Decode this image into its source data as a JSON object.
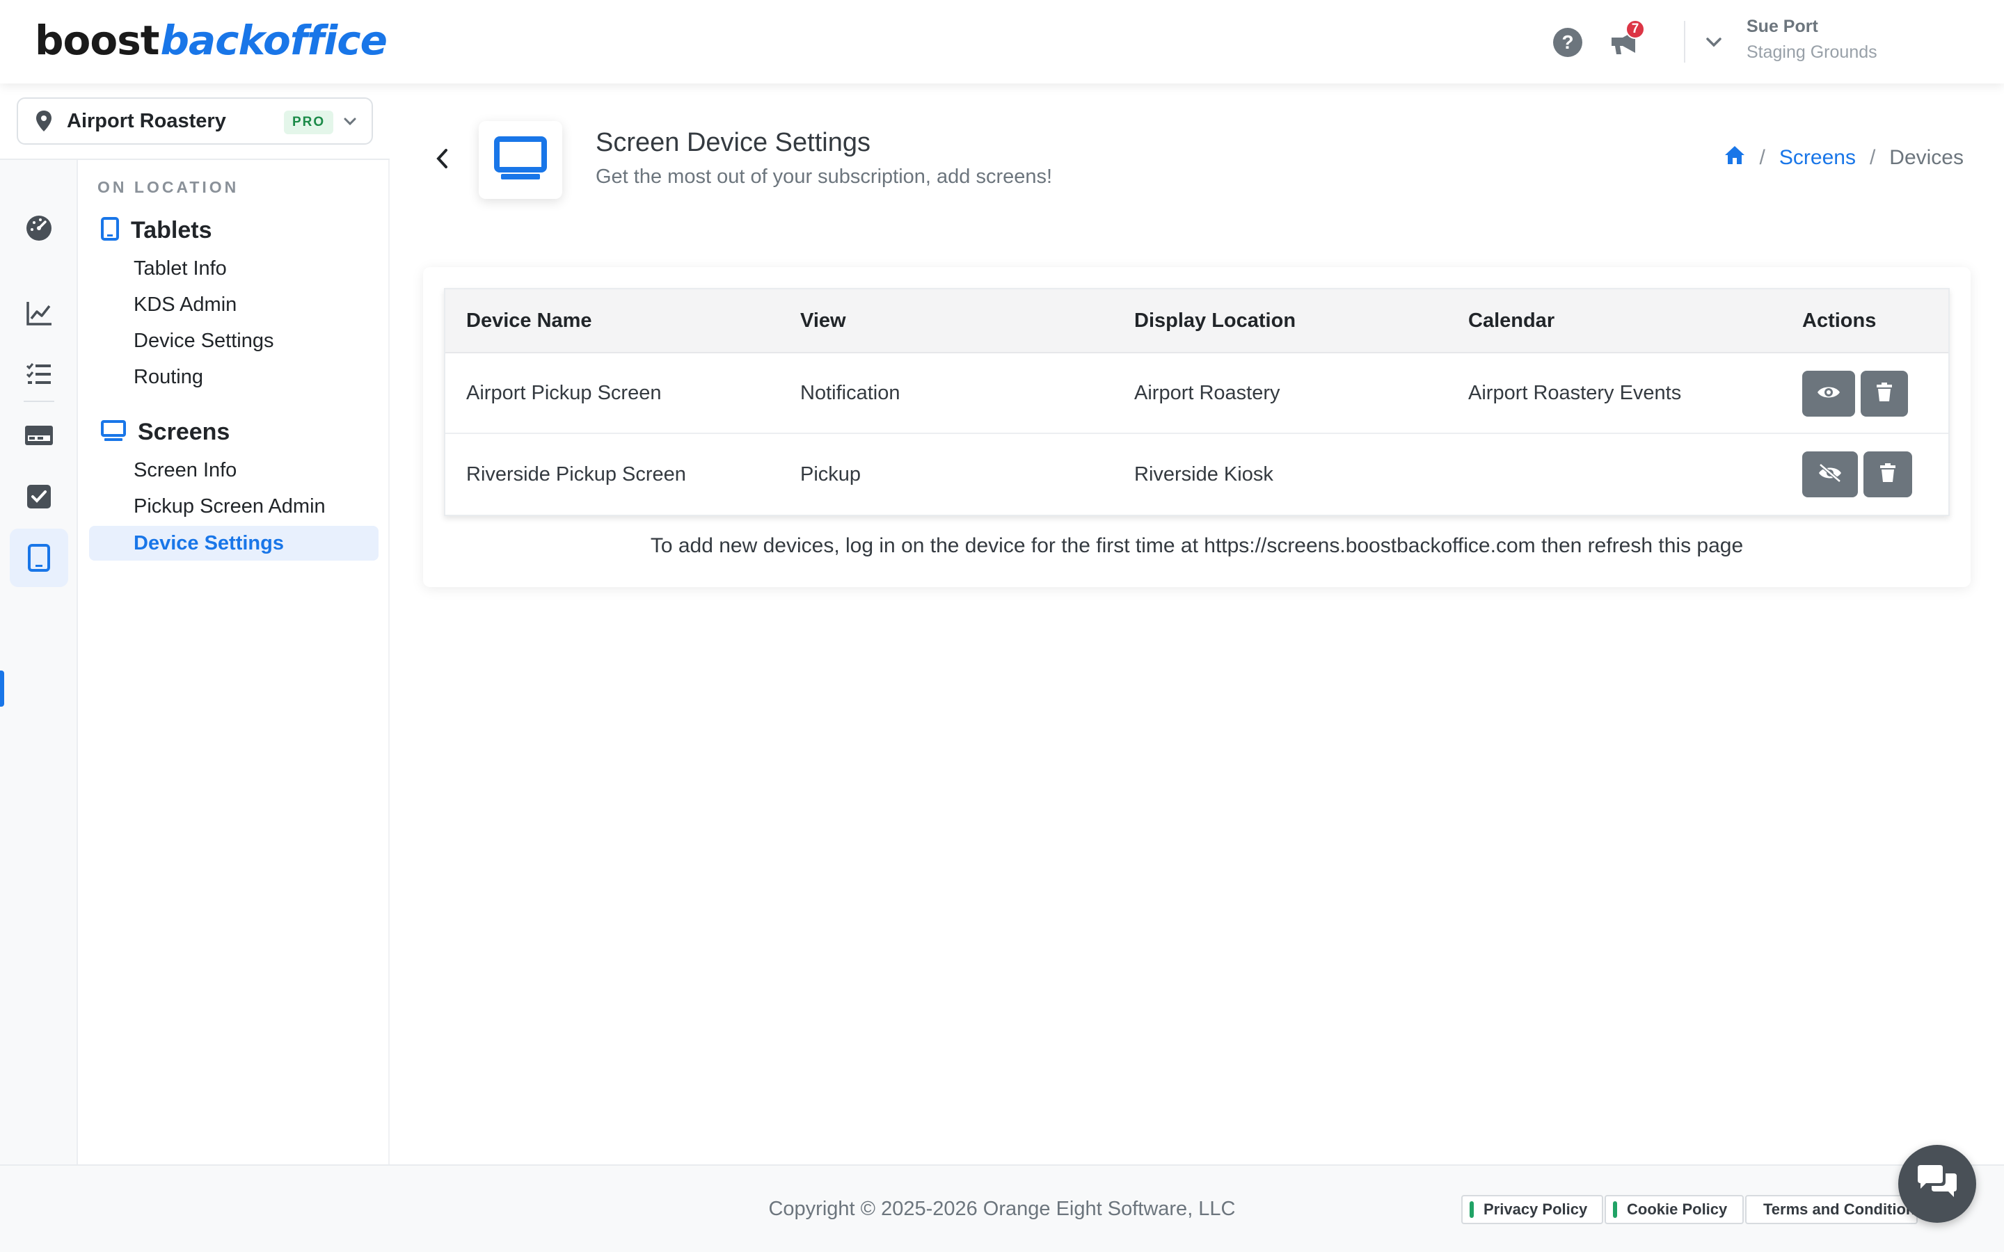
{
  "header": {
    "logo_part1": "boost",
    "logo_part2": "backoffice",
    "help_label": "?",
    "notifications_count": "7",
    "user_name": "Sue Port",
    "user_org": "Staging Grounds"
  },
  "location": {
    "name": "Airport Roastery",
    "plan_badge": "PRO"
  },
  "nav": {
    "section_label": "ON LOCATION",
    "groups": [
      {
        "label": "Tablets",
        "items": [
          "Tablet Info",
          "KDS Admin",
          "Device Settings",
          "Routing"
        ]
      },
      {
        "label": "Screens",
        "items": [
          "Screen Info",
          "Pickup Screen Admin",
          "Device Settings"
        ]
      }
    ],
    "active_item": "Device Settings"
  },
  "page": {
    "title": "Screen Device Settings",
    "subtitle": "Get the most out of your subscription, add screens!",
    "breadcrumb": [
      "Screens",
      "Devices"
    ]
  },
  "table": {
    "headers": [
      "Device Name",
      "View",
      "Display Location",
      "Calendar",
      "Actions"
    ],
    "rows": [
      {
        "device_name": "Airport Pickup Screen",
        "view": "Notification",
        "display_location": "Airport Roastery",
        "calendar": "Airport Roastery Events",
        "visible": true
      },
      {
        "device_name": "Riverside Pickup Screen",
        "view": "Pickup",
        "display_location": "Riverside Kiosk",
        "calendar": "",
        "visible": false
      }
    ],
    "note": "To add new devices, log in on the device for the first time at https://screens.boostbackoffice.com then refresh this page"
  },
  "footer": {
    "copyright": "Copyright © 2025-2026 Orange Eight Software, LLC",
    "links": [
      "Privacy Policy",
      "Cookie Policy",
      "Terms and Conditions"
    ]
  },
  "colors": {
    "accent": "#1976e8",
    "badge_red": "#dc3545",
    "pro_green": "#1b8a48",
    "button_gray": "#6c757d"
  },
  "icons": [
    "help-icon",
    "megaphone-icon",
    "chevron-down-icon",
    "map-pin-icon",
    "dashboard-icon",
    "chart-line-icon",
    "checklist-icon",
    "card-icon",
    "checkbox-icon",
    "tablet-icon",
    "monitor-icon",
    "chevron-left-icon",
    "home-icon",
    "eye-icon",
    "eye-slash-icon",
    "trash-icon",
    "chat-icon"
  ]
}
